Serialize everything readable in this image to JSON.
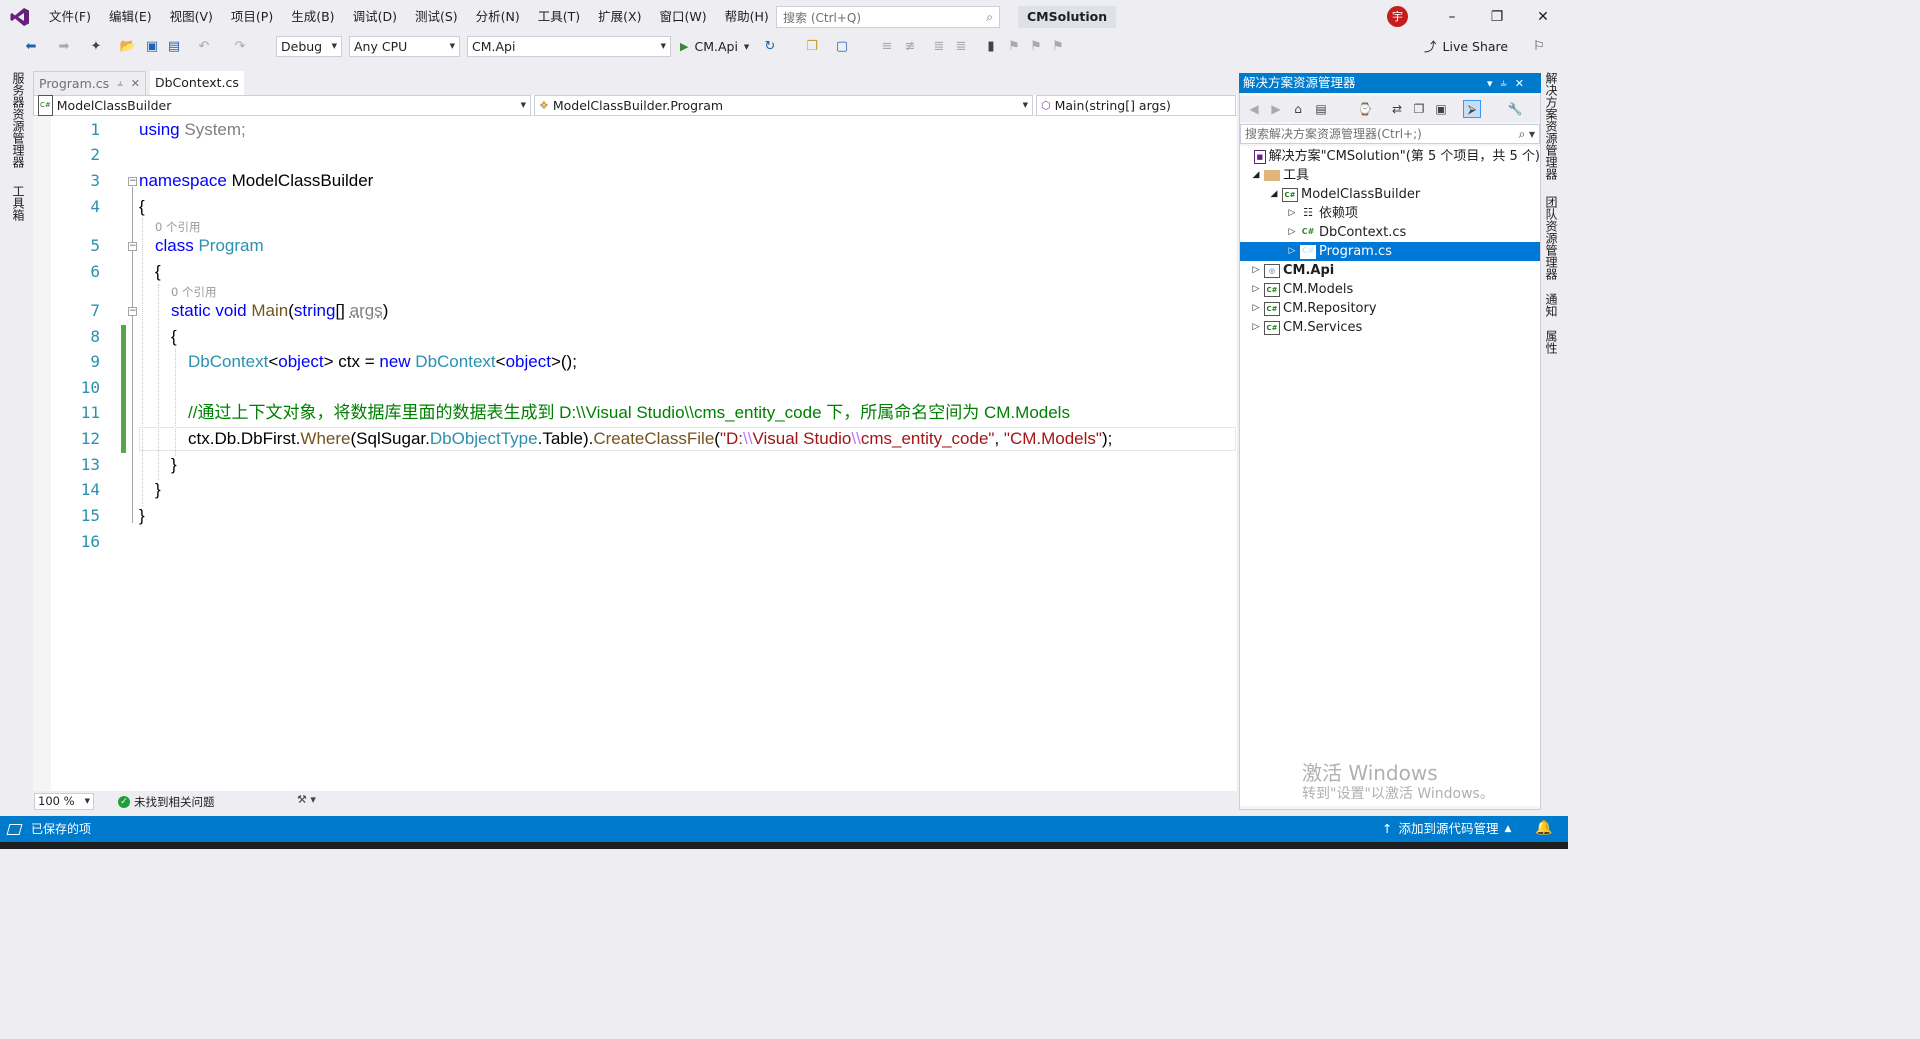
{
  "window": {
    "solution_name": "CMSolution",
    "avatar_letter": "宇",
    "search_placeholder": "搜索 (Ctrl+Q)"
  },
  "menu": [
    "文件(F)",
    "编辑(E)",
    "视图(V)",
    "项目(P)",
    "生成(B)",
    "调试(D)",
    "测试(S)",
    "分析(N)",
    "工具(T)",
    "扩展(X)",
    "窗口(W)",
    "帮助(H)"
  ],
  "toolbar": {
    "config": "Debug",
    "platform": "Any CPU",
    "startup_project": "CM.Api",
    "run_label": "CM.Api",
    "live_share": "Live Share"
  },
  "left_tabs": [
    "服务器资源管理器",
    "工具箱"
  ],
  "right_tabs": [
    "解决方案资源管理器",
    "团队资源管理器",
    "通知",
    "属性"
  ],
  "doc_tabs": [
    "Program.cs",
    "DbContext.cs"
  ],
  "nav_bar": {
    "project": "ModelClassBuilder",
    "type": "ModelClassBuilder.Program",
    "member": "Main(string[] args)"
  },
  "editor": {
    "line_numbers": [
      "1",
      "2",
      "3",
      "4",
      "5",
      "6",
      "7",
      "8",
      "9",
      "10",
      "11",
      "12",
      "13",
      "14",
      "15",
      "16"
    ],
    "codelens_text": "0 个引用",
    "code": {
      "l1_kw": "using",
      "l1_rest": " System;",
      "l3_kw": "namespace",
      "l3_rest": " ModelClassBuilder",
      "brace_open": "{",
      "brace_close": "}",
      "l5_kw": "class",
      "l5_type": " Program",
      "l7_kw1": "static",
      "l7_kw2": " void",
      "l7_fn": " Main",
      "l7_p1": "(",
      "l7_kw3": "string",
      "l7_p2": "[] ",
      "l7_param": "args",
      "l7_p3": ")",
      "l9_t1": "DbContext",
      "l9_lt": "<",
      "l9_k1": "object",
      "l9_mid": "> ctx = ",
      "l9_new": "new",
      "l9_t2": " DbContext",
      "l9_lt2": "<",
      "l9_k2": "object",
      "l9_end": ">();",
      "l11_comment": "//通过上下文对象，将数据库里面的数据表生成到 D:\\\\Visual Studio\\\\cms_entity_code 下，所属命名空间为 CM.Models",
      "l12_a": "ctx.Db.DbFirst.",
      "l12_where": "Where",
      "l12_b": "(SqlSugar.",
      "l12_type": "DbObjectType",
      "l12_c": ".Table).",
      "l12_fn": "CreateClassFile",
      "l12_d": "(",
      "l12_s1": "\"D:",
      "l12_e1": "\\\\",
      "l12_s2": "Visual Studio",
      "l12_e2": "\\\\",
      "l12_s3": "cms_entity_code\"",
      "l12_comma": ", ",
      "l12_s4": "\"CM.Models\"",
      "l12_end": ");"
    }
  },
  "editor_footer": {
    "zoom": "100 %",
    "issues": "未找到相关问题"
  },
  "solution_explorer": {
    "title": "解决方案资源管理器",
    "search_placeholder": "搜索解决方案资源管理器(Ctrl+;)",
    "tree": [
      {
        "label": "解决方案\"CMSolution\"(第 5 个项目，共 5 个)",
        "depth": 0,
        "icon": "solution"
      },
      {
        "label": "工具",
        "depth": 1,
        "icon": "folder",
        "expanded": true
      },
      {
        "label": "ModelClassBuilder",
        "depth": 2,
        "icon": "csproj",
        "expanded": true
      },
      {
        "label": "依赖项",
        "depth": 3,
        "icon": "dependencies"
      },
      {
        "label": "DbContext.cs",
        "depth": 3,
        "icon": "csfile"
      },
      {
        "label": "Program.cs",
        "depth": 3,
        "icon": "csfile",
        "selected": true
      },
      {
        "label": "CM.Api",
        "depth": 1,
        "icon": "webproj",
        "bold": true
      },
      {
        "label": "CM.Models",
        "depth": 1,
        "icon": "csproj"
      },
      {
        "label": "CM.Repository",
        "depth": 1,
        "icon": "csproj"
      },
      {
        "label": "CM.Services",
        "depth": 1,
        "icon": "csproj"
      }
    ]
  },
  "watermark": {
    "line1": "激活 Windows",
    "line2": "转到\"设置\"以激活 Windows。"
  },
  "statusbar": {
    "left": "已保存的项",
    "right": "添加到源代码管理"
  },
  "colors": {
    "accent": "#007acc",
    "keyword": "#0000ff",
    "type": "#2b91af",
    "comment": "#008000",
    "string": "#a31515"
  }
}
